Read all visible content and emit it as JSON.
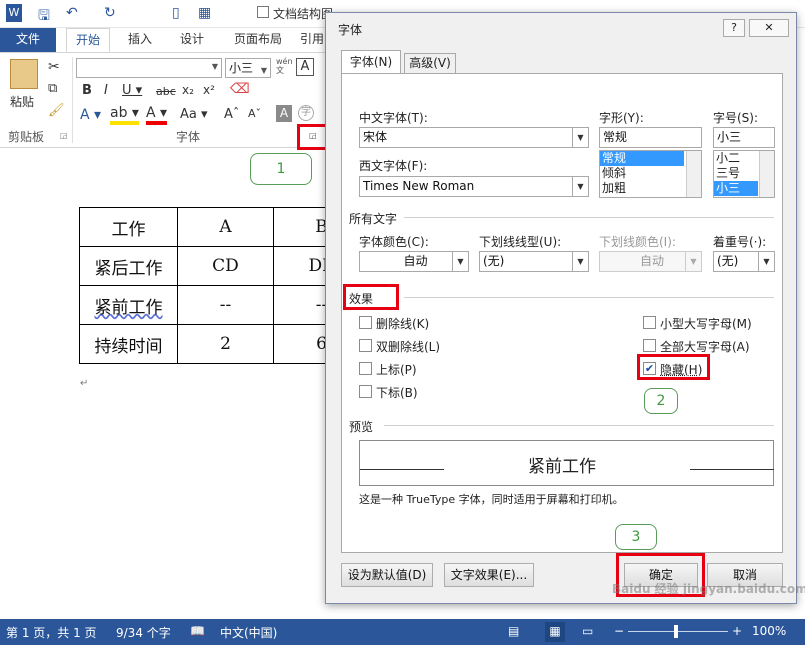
{
  "titlebar": {
    "doc_structure_label": "文档结构图"
  },
  "ribbon_tabs": [
    "文件",
    "开始",
    "插入",
    "设计",
    "页面布局",
    "引用"
  ],
  "ribbon": {
    "paste_label": "粘贴",
    "clipboard_group": "剪贴板",
    "font_group": "字体",
    "font_size": "小三",
    "wen_label": "wén 文"
  },
  "document_table": [
    [
      "工作",
      "A",
      "B"
    ],
    [
      "紧后工作",
      "CD",
      "DE"
    ],
    [
      "紧前工作",
      "--",
      "--"
    ],
    [
      "持续时间",
      "2",
      "6"
    ]
  ],
  "dialog": {
    "title": "字体",
    "help": "?",
    "close": "✕",
    "tabs": [
      "字体(N)",
      "高级(V)"
    ],
    "cn_font_label": "中文字体(T):",
    "cn_font_value": "宋体",
    "style_label": "字形(Y):",
    "style_value": "常规",
    "style_options": [
      "常规",
      "倾斜",
      "加粗"
    ],
    "size_label": "字号(S):",
    "size_value": "小三",
    "size_options": [
      "小二",
      "三号",
      "小三"
    ],
    "west_font_label": "西文字体(F):",
    "west_font_value": "Times New Roman",
    "all_text_label": "所有文字",
    "font_color_label": "字体颜色(C):",
    "font_color_value": "自动",
    "underline_label": "下划线线型(U):",
    "underline_value": "(无)",
    "underline_color_label": "下划线颜色(I):",
    "underline_color_value": "自动",
    "emphasis_label": "着重号(·):",
    "emphasis_value": "(无)",
    "effects_label": "效果",
    "effects_left": [
      "删除线(K)",
      "双删除线(L)",
      "上标(P)",
      "下标(B)"
    ],
    "effects_right": [
      "小型大写字母(M)",
      "全部大写字母(A)",
      "隐藏(H)"
    ],
    "preview_label": "预览",
    "preview_text": "紧前工作",
    "preview_note": "这是一种 TrueType 字体，同时适用于屏幕和打印机。",
    "set_default": "设为默认值(D)",
    "text_effects": "文字效果(E)...",
    "ok": "确定",
    "cancel": "取消"
  },
  "callouts": [
    "1",
    "2",
    "3"
  ],
  "statusbar": {
    "page": "第 1 页，共 1 页",
    "words": "9/34 个字",
    "lang": "中文(中国)",
    "zoom": "100%"
  },
  "watermark": "Baidu 经验 jingyan.baidu.com",
  "colors": {
    "accent": "#2b579a",
    "highlight": "#e60012",
    "callout": "#3f9a3f"
  }
}
